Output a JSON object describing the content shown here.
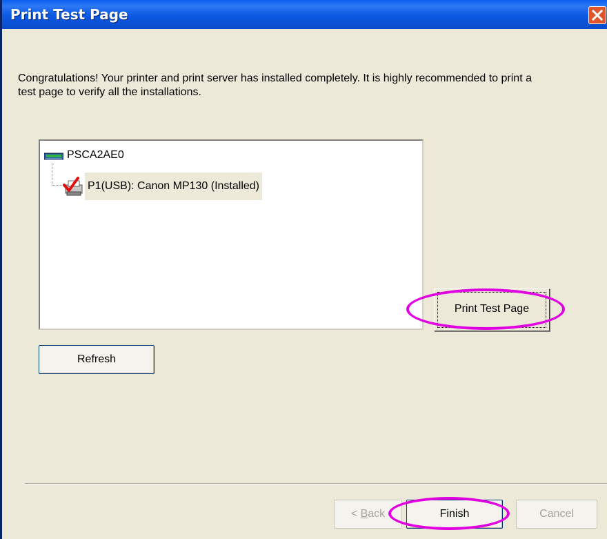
{
  "window": {
    "title": "Print Test Page"
  },
  "message": "Congratulations! Your printer and print server has installed completely. It is highly recommended to print a test page to verify all the installations.",
  "tree": {
    "server_name": "PSCA2AE0",
    "printer_label": "P1(USB): Canon MP130 (Installed)"
  },
  "buttons": {
    "print_test_page": "Print Test Page",
    "refresh": "Refresh",
    "back_prefix": "< ",
    "back_accel": "B",
    "back_rest": "ack",
    "finish": "Finish",
    "cancel": "Cancel"
  },
  "colors": {
    "title_bar": "#0A58E2",
    "dialog_bg": "#ECE9D8",
    "highlight_ellipse": "#E000E0",
    "close_button": "#E0552B"
  },
  "icons": {
    "server": "network-device-icon",
    "printer": "printer-installed-icon",
    "close": "close-icon"
  }
}
